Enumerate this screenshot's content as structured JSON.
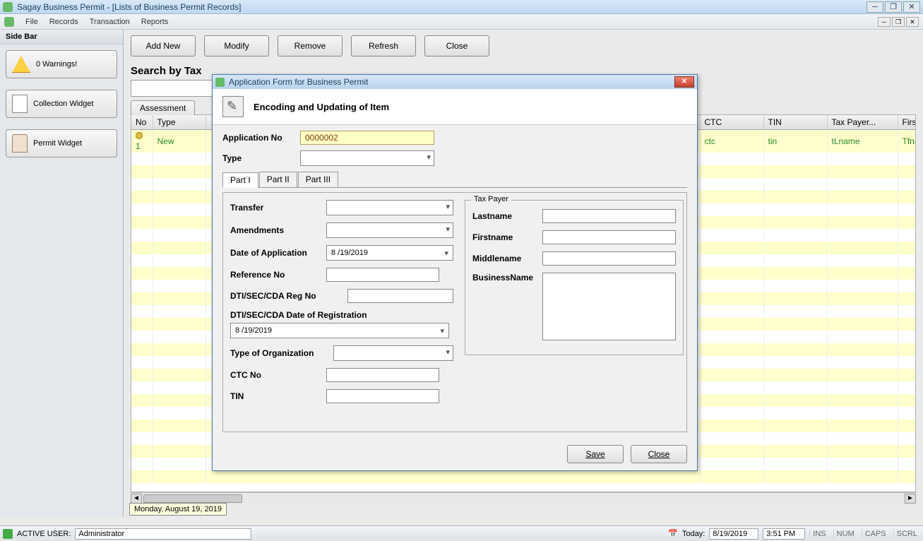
{
  "titlebar": {
    "title": "Sagay Business Permit - [Lists of Business Permit Records]"
  },
  "menubar": {
    "file": "File",
    "records": "Records",
    "transaction": "Transaction",
    "reports": "Reports"
  },
  "sidebar": {
    "title": "Side Bar",
    "warnings": "0 Warnings!",
    "collection": "Collection Widget",
    "permit": "Permit Widget"
  },
  "toolbar": {
    "add": "Add New",
    "modify": "Modify",
    "remove": "Remove",
    "refresh": "Refresh",
    "close": "Close"
  },
  "search": {
    "label": "Search by Tax",
    "assessment_tab": "Assessment"
  },
  "table": {
    "headers": {
      "no": "No",
      "type": "Type",
      "ctc": "CTC",
      "tin": "TIN",
      "taxpayer": "Tax Payer...",
      "first": "First"
    },
    "row": {
      "no": "1",
      "type": "New",
      "ctc": "ctc",
      "tin": "tin",
      "taxpayer": "tLname",
      "first": "Tfna"
    }
  },
  "date_tip": "Monday, August 19, 2019",
  "dialog": {
    "title": "Application Form for Business Permit",
    "header": "Encoding and Updating of Item",
    "app_no_label": "Application No",
    "app_no_value": "0000002",
    "type_label": "Type",
    "tabs": {
      "p1": "Part I",
      "p2": "Part II",
      "p3": "Part III"
    },
    "transfer": "Transfer",
    "amendments": "Amendments",
    "date_app": "Date of Application",
    "date_app_val": "8 /19/2019",
    "ref_no": "Reference No",
    "dti_reg": "DTI/SEC/CDA Reg No",
    "dti_date": "DTI/SEC/CDA Date of Registration",
    "dti_date_val": "8 /19/2019",
    "type_org": "Type of Organization",
    "ctc_no": "CTC No",
    "tin": "TIN",
    "taxpayer": {
      "legend": "Tax Payer",
      "lastname": "Lastname",
      "firstname": "Firstname",
      "middlename": "Middlename",
      "businessname": "BusinessName"
    },
    "save": "Save",
    "close": "Close"
  },
  "statusbar": {
    "active_user_label": "ACTIVE USER:",
    "active_user_value": "Administrator",
    "today_label": "Today:",
    "today_value": "8/19/2019",
    "time": "3:51 PM",
    "ins": "INS",
    "num": "NUM",
    "caps": "CAPS",
    "scrl": "SCRL"
  }
}
